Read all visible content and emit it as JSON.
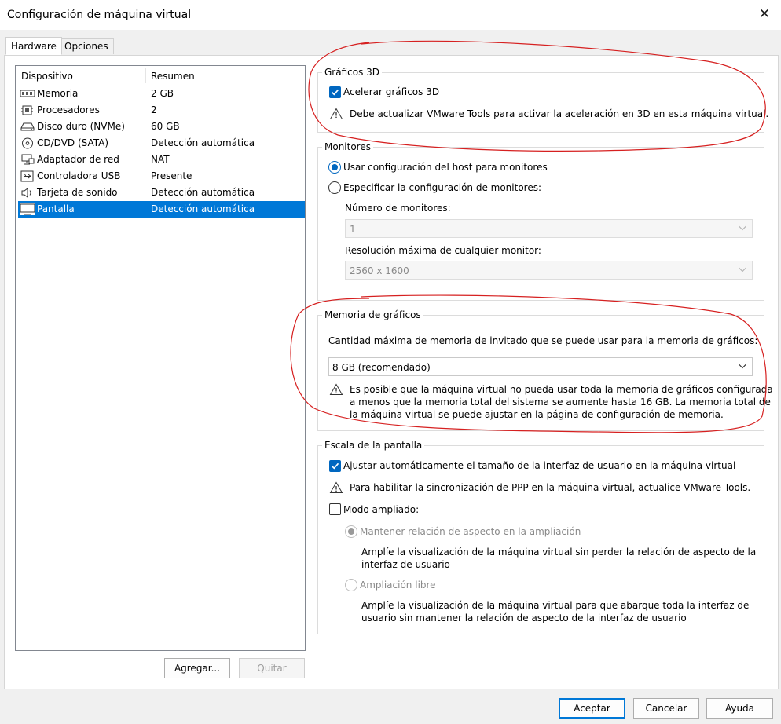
{
  "window": {
    "title": "Configuración de máquina virtual",
    "close_glyph": "✕"
  },
  "tabs": [
    {
      "label": "Hardware"
    },
    {
      "label": "Opciones"
    }
  ],
  "device_list": {
    "col_device": "Dispositivo",
    "col_summary": "Resumen",
    "items": [
      {
        "name": "Memoria",
        "summary": "2 GB",
        "icon": "memory-icon"
      },
      {
        "name": "Procesadores",
        "summary": "2",
        "icon": "processor-icon"
      },
      {
        "name": "Disco duro (NVMe)",
        "summary": "60 GB",
        "icon": "hard-disk-icon"
      },
      {
        "name": "CD/DVD (SATA)",
        "summary": "Detección automática",
        "icon": "cd-dvd-icon"
      },
      {
        "name": "Adaptador de red",
        "summary": "NAT",
        "icon": "network-adapter-icon"
      },
      {
        "name": "Controladora USB",
        "summary": "Presente",
        "icon": "usb-icon"
      },
      {
        "name": "Tarjeta de sonido",
        "summary": "Detección automática",
        "icon": "speaker-icon"
      },
      {
        "name": "Pantalla",
        "summary": "Detección automática",
        "icon": "monitor-icon",
        "selected": true
      }
    ],
    "add_label": "Agregar...",
    "remove_label": "Quitar"
  },
  "graphics3d": {
    "legend": "Gráficos 3D",
    "accelerate_label": "Acelerar gráficos 3D",
    "accelerate_checked": true,
    "warning": "Debe actualizar VMware Tools para activar la aceleración en 3D en esta máquina virtual."
  },
  "monitors": {
    "legend": "Monitores",
    "use_host_label": "Usar configuración del host para monitores",
    "specify_label": "Especificar la configuración de monitores:",
    "selected": "use_host",
    "count_label": "Número de monitores:",
    "count_value": "1",
    "resolution_label": "Resolución máxima de cualquier monitor:",
    "resolution_value": "2560 x 1600"
  },
  "graphics_memory": {
    "legend": "Memoria de gráficos",
    "max_label": "Cantidad máxima de memoria de invitado que se puede usar para la memoria de gráficos:",
    "value": "8 GB (recomendado)",
    "warning_line1": "Es posible que la máquina virtual no pueda usar toda la memoria de gráficos configurada",
    "warning_line2": "a menos que la memoria total del sistema se aumente hasta 16 GB. La memoria total de",
    "warning_line3": "la máquina virtual se puede ajustar en la página de configuración de memoria."
  },
  "display_scaling": {
    "legend": "Escala de la pantalla",
    "autofit_label": "Ajustar automáticamente el tamaño de la interfaz de usuario en la máquina virtual",
    "autofit_checked": true,
    "ppp_warning": "Para habilitar la sincronización de PPP en la máquina virtual, actualice VMware Tools.",
    "stretch_label": "Modo ampliado:",
    "stretch_checked": false,
    "keep_aspect_label": "Mantener relación de aspecto en la ampliación",
    "keep_aspect_desc_line1": "Amplíe la visualización de la máquina virtual sin perder la relación de aspecto de la",
    "keep_aspect_desc_line2": "interfaz de usuario",
    "free_label": "Ampliación libre",
    "free_desc_line1": "Amplíe la visualización de la máquina virtual para que abarque toda la interfaz de",
    "free_desc_line2": "usuario sin mantener la relación de aspecto de la interfaz de usuario"
  },
  "footer": {
    "ok_label": "Aceptar",
    "cancel_label": "Cancelar",
    "help_label": "Ayuda"
  },
  "colors": {
    "accent": "#0078d7",
    "checkbox": "#0067c0",
    "annotation": "#d62020"
  }
}
